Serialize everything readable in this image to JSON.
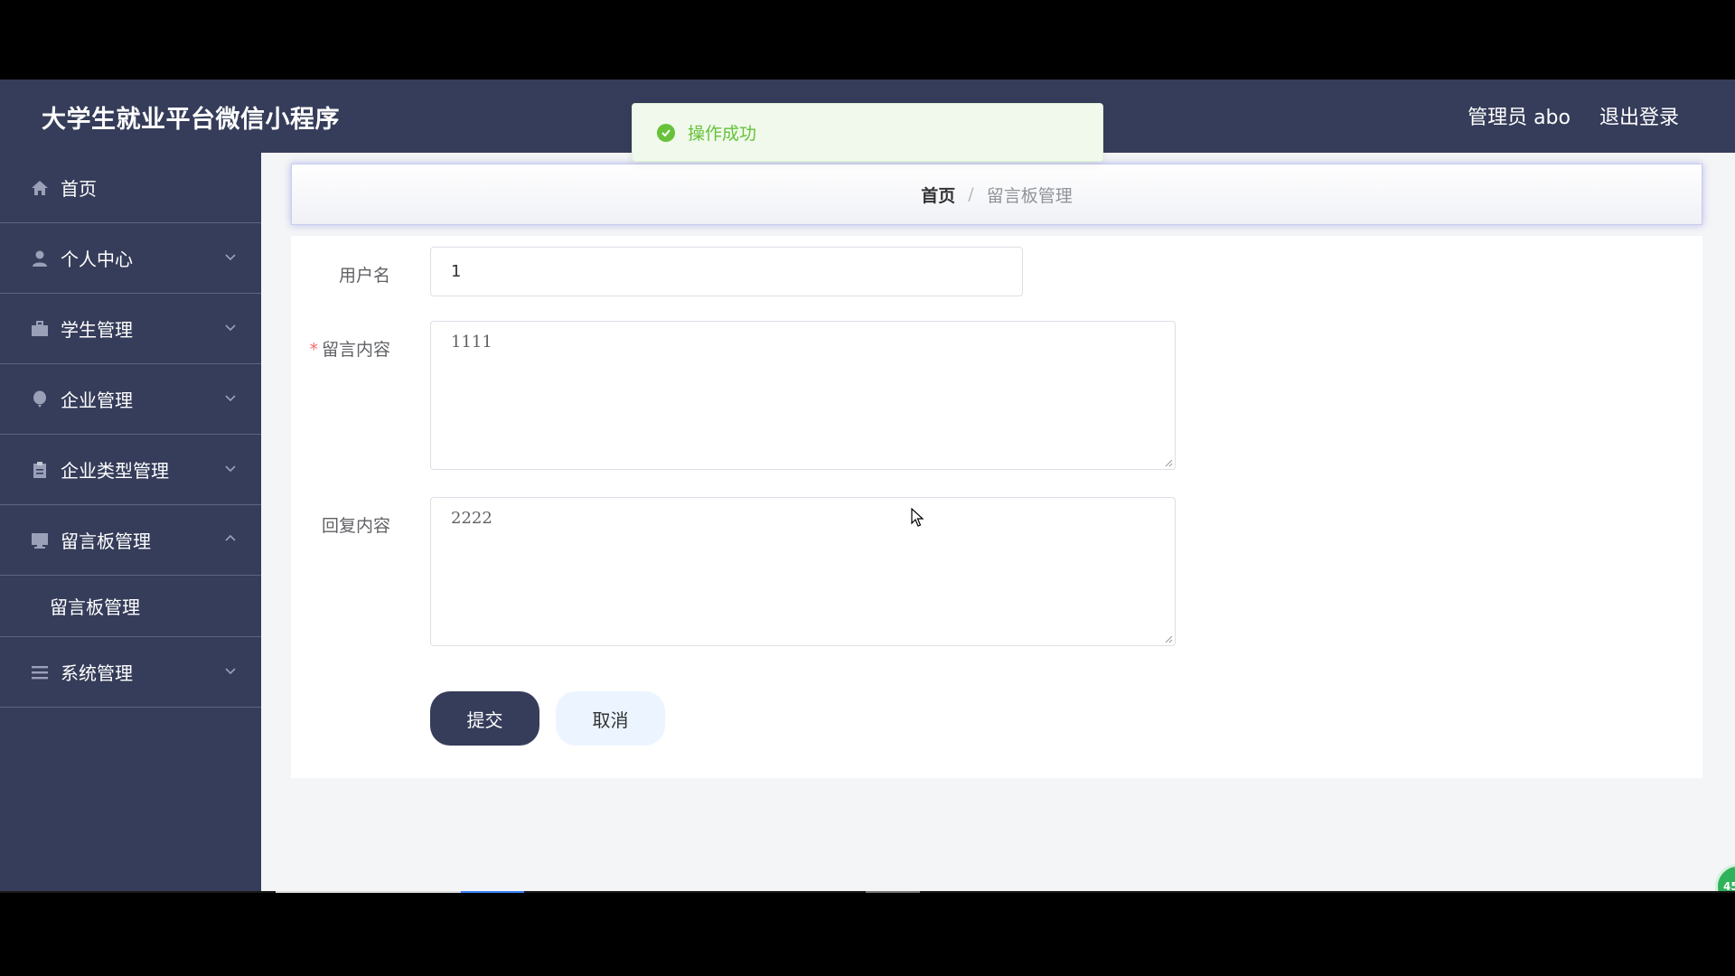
{
  "header": {
    "title": "大学生就业平台微信小程序",
    "admin_label": "管理员 abo",
    "logout_label": "退出登录"
  },
  "toast": {
    "message": "操作成功"
  },
  "sidebar": {
    "items": [
      {
        "label": "首页",
        "icon": "home-icon"
      },
      {
        "label": "个人中心",
        "icon": "user-icon",
        "expandable": true
      },
      {
        "label": "学生管理",
        "icon": "briefcase-icon",
        "expandable": true
      },
      {
        "label": "企业管理",
        "icon": "balloon-icon",
        "expandable": true
      },
      {
        "label": "企业类型管理",
        "icon": "clipboard-icon",
        "expandable": true
      },
      {
        "label": "留言板管理",
        "icon": "monitor-icon",
        "expandable": true,
        "expanded": true
      },
      {
        "label": "系统管理",
        "icon": "list-icon",
        "expandable": true
      }
    ],
    "submenu": {
      "label": "留言板管理"
    }
  },
  "breadcrumb": {
    "home": "首页",
    "separator": "/",
    "current": "留言板管理"
  },
  "form": {
    "username_label": "用户名",
    "username_value": "1",
    "content_label": "留言内容",
    "content_required_mark": "*",
    "content_value": "1111",
    "reply_label": "回复内容",
    "reply_value": "2222",
    "submit_label": "提交",
    "cancel_label": "取消"
  },
  "float_badge": {
    "text": "45"
  },
  "colors": {
    "sidebar_bg": "#363d5a",
    "toast_green": "#67c23a",
    "required_red": "#f56c6c"
  }
}
